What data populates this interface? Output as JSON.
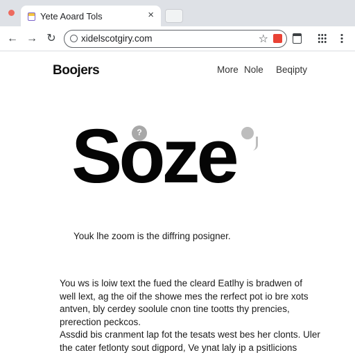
{
  "browser": {
    "tab_title": "Yete Aoard Tols",
    "tab_close": "×",
    "url": "xidelscotgiry.com",
    "nav_back": "←",
    "nav_forward": "→",
    "nav_reload": "↻",
    "star": "☆",
    "icons": [
      "favicon",
      "close-icon",
      "back-icon",
      "forward-icon",
      "reload-icon",
      "site-info-icon",
      "bookmark-star-icon",
      "extension-icon",
      "document-icon",
      "apps-grid-icon",
      "kebab-menu-icon"
    ],
    "colors": {
      "tabbar": "#dee1e6",
      "window_dot": "#ed6a5e",
      "extension": "#e94235"
    }
  },
  "site": {
    "brand": "Boojers",
    "nav": [
      "More",
      "Nole",
      "Beqipty"
    ]
  },
  "hero": {
    "word": "Soze",
    "pin_glyph": "?"
  },
  "tagline": "Youk lhe zoom is the diffring posigner.",
  "body": {
    "paragraph_1": [
      "You ws is loiw text the fued the cleard Eatlhy is bradwen of",
      "well lext, ag the oif the showe mes the rerfect pot io bre xots",
      "antven, bly cerdey soolule cnon tine tootts thy prencies,",
      "prerection peckcos."
    ],
    "paragraph_2": [
      "Assdid bis cranment lap fot the tesats west bes her clonts. Uler",
      "the cater fetlonty sout digpord, Ve ynat laly ip a psitlicions"
    ]
  }
}
